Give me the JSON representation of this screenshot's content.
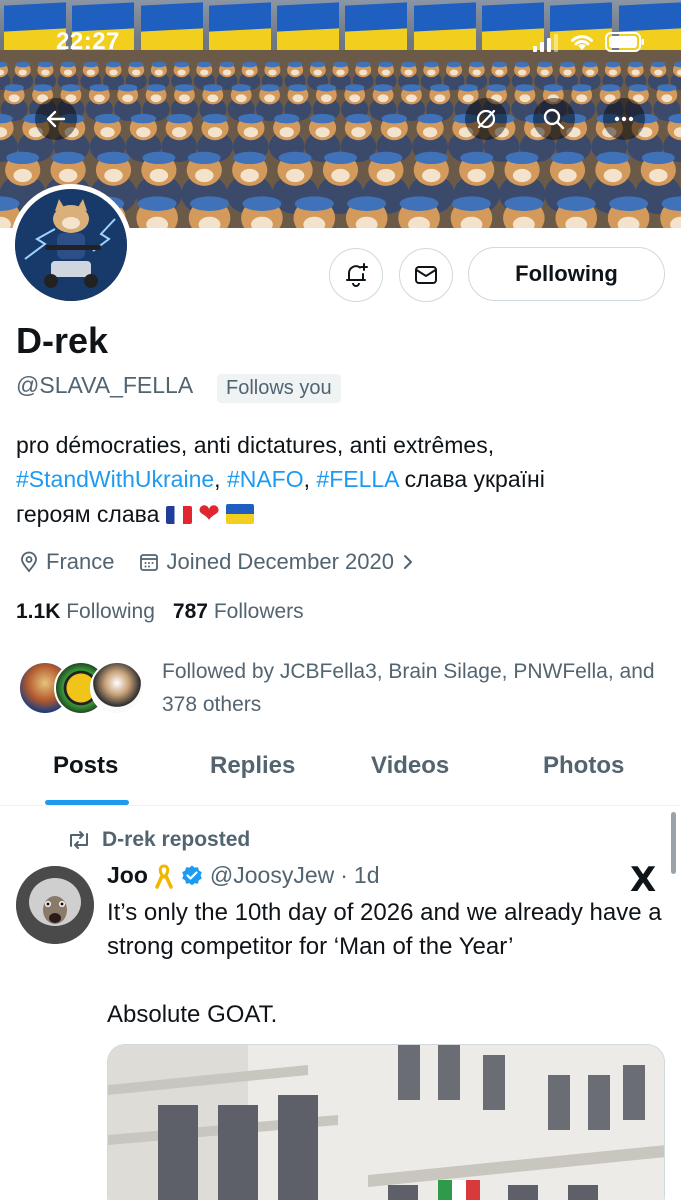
{
  "status_bar": {
    "time": "22:27"
  },
  "colors": {
    "accent": "#1d9bf0",
    "text_primary": "#0f1419",
    "text_secondary": "#536471",
    "border": "#cfd9de"
  },
  "header_buttons": [
    "back-arrow-icon",
    "grok-icon",
    "search-icon",
    "more-icon"
  ],
  "profile": {
    "display_name": "D-rek",
    "handle": "@SLAVA_FELLA",
    "follows_you": "Follows you",
    "bio_text_1": "pro démocraties, anti dictatures, anti extrêmes,",
    "bio_tag_1": "#StandWithUkraine",
    "bio_sep_1": ", ",
    "bio_tag_2": "#NAFO",
    "bio_sep_2": ", ",
    "bio_tag_3": "#FELLA",
    "bio_text_2": " слава україні",
    "bio_text_3": "героям слава",
    "location": "France",
    "joined": "Joined December 2020",
    "following_count": "1.1K",
    "following_label": "Following",
    "followers_count": "787",
    "followers_label": "Followers",
    "followed_by": "Followed by JCBFella3, Brain Silage, PNWFella, and 378 others"
  },
  "actions": {
    "following_button": "Following"
  },
  "tabs": [
    {
      "label": "Posts",
      "active": true
    },
    {
      "label": "Replies",
      "active": false
    },
    {
      "label": "Videos",
      "active": false
    },
    {
      "label": "Photos",
      "active": false
    }
  ],
  "post": {
    "repost_label": "D-rek reposted",
    "author_name": "Joo",
    "author_handle": "@JoosyJew",
    "separator": "·",
    "time": "1d",
    "text_1": "It’s only the 10th day of 2026 and we already have a strong competitor for ‘Man of the Year’",
    "text_2": "Absolute GOAT.",
    "x_logo": "X"
  }
}
